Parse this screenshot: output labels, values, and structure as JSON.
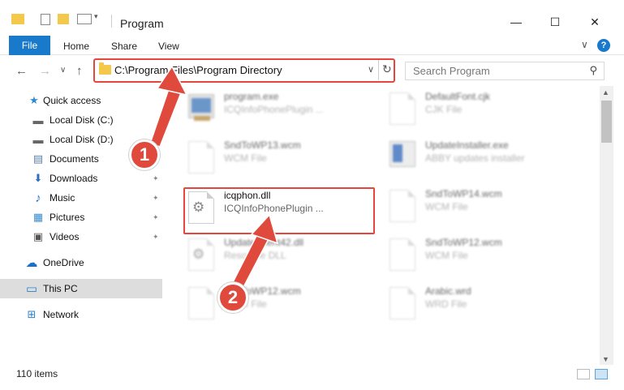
{
  "window": {
    "title": "Program",
    "minimize_glyph": "—",
    "maximize_glyph": "☐",
    "close_glyph": "✕"
  },
  "ribbon": {
    "tabs": [
      "File",
      "Home",
      "Share",
      "View"
    ],
    "expand_glyph": "∨",
    "help_glyph": "?"
  },
  "nav": {
    "back_glyph": "←",
    "forward_glyph": "→",
    "recent_glyph": "∨",
    "up_glyph": "↑"
  },
  "address": {
    "path": "C:\\Program Files\\Program Directory",
    "dropdown_glyph": "∨",
    "refresh_glyph": "↻"
  },
  "search": {
    "placeholder": "Search Program",
    "icon_glyph": "⚲"
  },
  "sidebar": {
    "items": [
      {
        "label": "Quick access",
        "icon": "star-icon",
        "glyph": "★",
        "pinned": false
      },
      {
        "label": "Local Disk (C:)",
        "icon": "drive-icon",
        "glyph": "▬",
        "pinned": false
      },
      {
        "label": "Local Disk (D:)",
        "icon": "drive-icon",
        "glyph": "▬",
        "pinned": true
      },
      {
        "label": "Documents",
        "icon": "documents-icon",
        "glyph": "▤",
        "pinned": true
      },
      {
        "label": "Downloads",
        "icon": "downloads-icon",
        "glyph": "⬇",
        "pinned": true
      },
      {
        "label": "Music",
        "icon": "music-icon",
        "glyph": "♪",
        "pinned": true
      },
      {
        "label": "Pictures",
        "icon": "pictures-icon",
        "glyph": "▦",
        "pinned": true
      },
      {
        "label": "Videos",
        "icon": "videos-icon",
        "glyph": "▣",
        "pinned": true
      },
      {
        "label": "OneDrive",
        "icon": "cloud-icon",
        "glyph": "☁",
        "pinned": false
      },
      {
        "label": "This PC",
        "icon": "computer-icon",
        "glyph": "▭",
        "pinned": false,
        "selected": true
      },
      {
        "label": "Network",
        "icon": "network-icon",
        "glyph": "⊞",
        "pinned": false
      }
    ],
    "pin_glyph": "📌"
  },
  "files": {
    "left": [
      {
        "name": "program.exe",
        "type": "ICQInfoPhonePlugin ...",
        "icon": "exe-icon"
      },
      {
        "name": "SndToWP13.wcm",
        "type": "WCM File",
        "icon": "document-icon"
      },
      {
        "name": "icqphon.dll",
        "type": "ICQInfoPhonePlugin ...",
        "icon": "dll-gear-icon",
        "highlighted": true
      },
      {
        "name": "UpdateClient42.dll",
        "type": "Resource DLL",
        "icon": "dll-gear-icon"
      },
      {
        "name": "SndToWP12.wcm",
        "type": "WCM File",
        "icon": "document-icon"
      }
    ],
    "right": [
      {
        "name": "DefaultFont.cjk",
        "type": "CJK File",
        "icon": "document-icon"
      },
      {
        "name": "UpdateInstaller.exe",
        "type": "ABBY updates installer",
        "icon": "installer-icon"
      },
      {
        "name": "SndToWP14.wcm",
        "type": "WCM File",
        "icon": "document-icon"
      },
      {
        "name": "SndToWP12.wcm",
        "type": "WCM File",
        "icon": "document-icon"
      },
      {
        "name": "Arabic.wrd",
        "type": "WRD File",
        "icon": "document-icon"
      }
    ]
  },
  "status": {
    "item_count": "110 items"
  },
  "annotations": {
    "step1": "1",
    "step2": "2"
  },
  "colors": {
    "accent": "#1979ca",
    "highlight_red": "#e8453c",
    "callout_red": "#e04a3c",
    "folder_yellow": "#f3c84b"
  }
}
